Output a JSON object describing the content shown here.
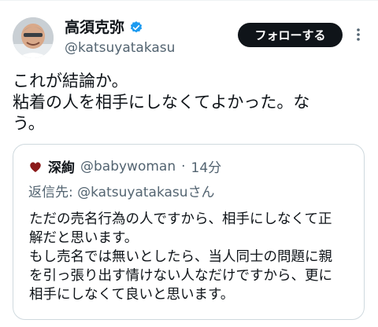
{
  "author": {
    "display_name": "高須克弥",
    "handle": "@katsuyatakasu",
    "verified_icon": "verified-badge-icon",
    "avatar_icon": "avatar"
  },
  "header": {
    "follow_label": "フォローする",
    "more_icon": "more-vertical-icon"
  },
  "tweet": {
    "lines": [
      "これが結論か。",
      "粘着の人を相手にしなくてよかった。な",
      "う。"
    ]
  },
  "quote": {
    "author_name": "深絢",
    "handle": "@babywoman",
    "separator": "·",
    "time": "14分",
    "reply_prefix": "返信先:",
    "reply_mention": "@katsuyatakasu",
    "reply_suffix": "さん",
    "body_lines": [
      "ただの売名行為の人ですから、相手にしなくて正",
      "解だと思います。",
      "もし売名では無いとしたら、当人同士の問題に親",
      "を引っ張り出す情けない人なだけですから、更に",
      "相手にしなくて良いと思います。"
    ]
  },
  "colors": {
    "text_primary": "#0f1419",
    "text_secondary": "#536471",
    "verified_blue": "#1d9bf0",
    "follow_bg": "#0f1419",
    "border": "#cfd9de"
  }
}
